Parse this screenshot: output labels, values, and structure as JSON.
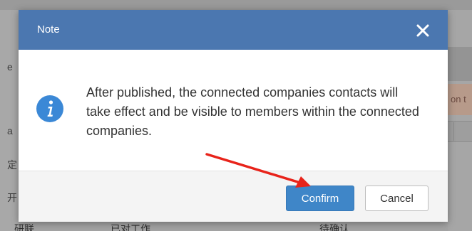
{
  "dialog": {
    "title": "Note",
    "close_icon": "close-icon",
    "info_icon": "info-icon",
    "message": "After published, the connected companies contacts will take effect and be visible to members within the connected companies.",
    "confirm_label": "Confirm",
    "cancel_label": "Cancel"
  },
  "background": {
    "warning_fragment": "on t",
    "left_fragments": [
      "e",
      "a",
      "定",
      "开"
    ],
    "bottom_fragments": [
      "研联",
      "已对工作",
      "待确认"
    ]
  },
  "annotation": {
    "arrow_color": "#e8231a",
    "arrow_target": "confirm-button"
  },
  "colors": {
    "header": "#4b77b0",
    "confirm_button": "#3f86c8",
    "info_icon": "#3b88d6"
  }
}
